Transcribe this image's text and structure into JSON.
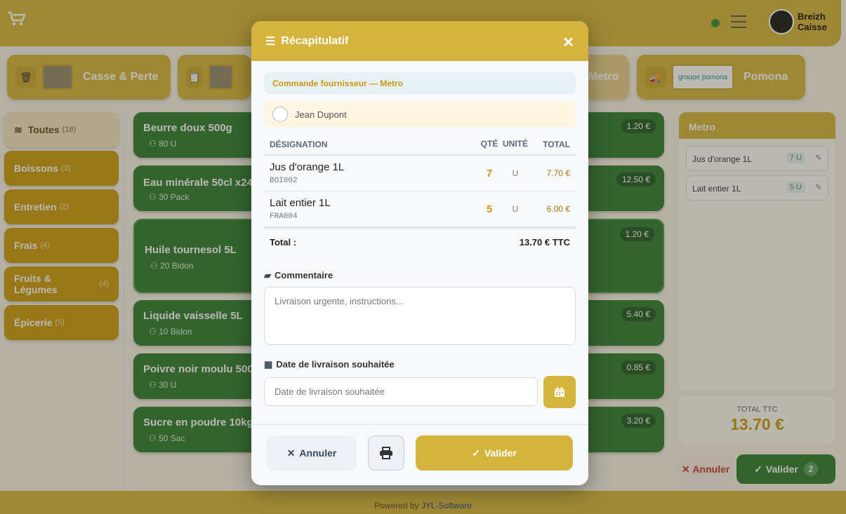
{
  "app": {
    "logo_line1": "Breizh",
    "logo_line2": "Caisse",
    "footer_prefix": "Powered by",
    "footer_brand": "JYL-Software"
  },
  "suppliers": [
    {
      "label": "Casse & Perte",
      "icon": "trash-icon"
    },
    {
      "label": "",
      "icon": "clipboard-icon"
    },
    {
      "label": "Metro",
      "icon": "truck-icon"
    },
    {
      "label": "Pomona",
      "icon": "truck-icon",
      "logo_text": "groupe pomona"
    }
  ],
  "categories": [
    {
      "label": "Toutes",
      "count": "(18)"
    },
    {
      "label": "Boissons",
      "count": "(3)"
    },
    {
      "label": "Entretien",
      "count": "(2)"
    },
    {
      "label": "Frais",
      "count": "(4)"
    },
    {
      "label": "Fruits & Légumes",
      "count": "(4)"
    },
    {
      "label": "Épicerie",
      "count": "(5)"
    }
  ],
  "products": [
    {
      "name": "Beurre doux 500g",
      "stock": "80 U",
      "price": "1.20 €"
    },
    {
      "name": "Eau minérale 50cl x24",
      "stock": "30 Pack",
      "price": "12.50 €"
    },
    {
      "name": "Huile tournesol 5L",
      "stock": "20 Bidon",
      "price": "1.20 €"
    },
    {
      "name": "Liquide vaisselle 5L",
      "stock": "10 Bidon",
      "price": "5.40 €"
    },
    {
      "name": "Poivre noir moulu 500",
      "stock": "30 U",
      "price": "0.85 €"
    },
    {
      "name": "Sucre en poudre 10kg",
      "stock": "50 Sac",
      "price": "3.20 €"
    }
  ],
  "cart": {
    "title": "Metro",
    "lines": [
      {
        "name": "Jus d'orange 1L",
        "qty": "7 U"
      },
      {
        "name": "Lait entier 1L",
        "qty": "5 U"
      }
    ],
    "total_label": "TOTAL TTC",
    "total_value": "13.70 €",
    "cancel_label": "Annuler",
    "validate_label": "Valider",
    "validate_count": "2"
  },
  "modal": {
    "title": "Récapitulatif",
    "order_label": "Commande fournisseur — Metro",
    "user": "Jean Dupont",
    "columns": {
      "designation": "DÉSIGNATION",
      "qty": "QTÉ",
      "unit": "UNITÉ",
      "total": "TOTAL"
    },
    "rows": [
      {
        "name": "Jus d'orange 1L",
        "code": "BOI002",
        "qty": "7",
        "unit": "U",
        "total": "7.70 €"
      },
      {
        "name": "Lait entier 1L",
        "code": "FRA004",
        "qty": "5",
        "unit": "U",
        "total": "6.00 €"
      }
    ],
    "total_label": "Total :",
    "total_value": "13.70 € TTC",
    "comment_label": "Commentaire",
    "comment_placeholder": "Livraison urgente, instructions...",
    "date_label": "Date de livraison souhaitée",
    "date_placeholder": "Date de livraison souhaitée",
    "cancel_label": "Annuler",
    "validate_label": "Valider"
  }
}
